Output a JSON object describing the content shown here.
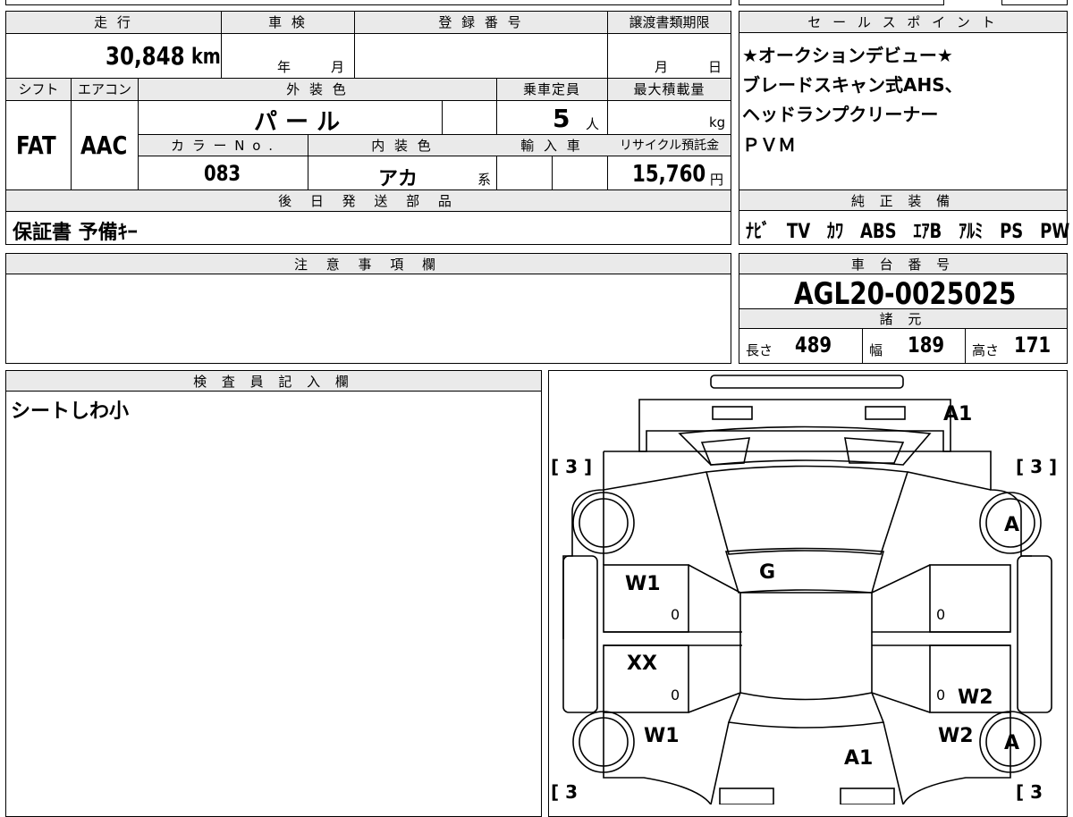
{
  "topstrip": {},
  "main": {
    "headers": {
      "mileage": "走 行",
      "inspection": "車 検",
      "registration": "登 録 番 号",
      "transfer_deadline": "譲渡書類期限",
      "shift": "シフト",
      "aircon": "エアコン",
      "exterior_color": "外 装 色",
      "capacity": "乗車定員",
      "max_load": "最大積載量",
      "color_no": "カ ラ ー N o .",
      "interior_color": "内 装 色",
      "import": "輸 入 車",
      "recycle_fee": "リサイクル預託金",
      "later_shipping": "後 日 発 送 部 品"
    },
    "mileage_value": "30,848",
    "mileage_unit": "km",
    "inspection_year_unit": "年",
    "inspection_month_unit": "月",
    "deadline_month_unit": "月",
    "deadline_day_unit": "日",
    "shift_value": "FAT",
    "aircon_value": "AAC",
    "exterior_color_value": "パ ー ル",
    "capacity_value": "5",
    "capacity_unit": "人",
    "max_load_unit": "kg",
    "color_no_value": "083",
    "interior_color_value": "アカ",
    "interior_color_suffix": "系",
    "recycle_fee_value": "15,760",
    "recycle_fee_unit": "円",
    "later_shipping_value": "保証書 予備ｷｰ"
  },
  "sales": {
    "header": "セ ー ル ス ポ イ ン ト",
    "lines": [
      "★オークションデビュー★",
      "ブレードスキャン式AHS、",
      "ヘッドランプクリーナー",
      "ＰＶＭ"
    ]
  },
  "equipment": {
    "header": "純 正 装 備",
    "items": [
      "ﾅﾋﾞ",
      "TV",
      "ｶﾜ",
      "ABS",
      "ｴｱB",
      "ｱﾙﾐ",
      "PS",
      "PW"
    ]
  },
  "notes": {
    "header": "注 意 事 項 欄"
  },
  "chassis": {
    "header": "車 台 番 号",
    "value": "AGL20-0025025",
    "specs_header": "諸 元",
    "length_label": "長さ",
    "length_value": "489",
    "width_label": "幅",
    "width_value": "189",
    "height_label": "高さ",
    "height_value": "171"
  },
  "inspector": {
    "header": "検 査 員 記 入 欄",
    "text": "シートしわ小"
  },
  "diagram": {
    "labels": {
      "rear_bumper": "A1",
      "front_bumper": "A1",
      "windshield": "G",
      "left_front_door": "W1",
      "left_rear_door": "XX",
      "left_rear_fender": "W1",
      "right_rear_door": "W2",
      "right_rear_fender": "W2",
      "right_top_wheel": "A",
      "right_bottom_wheel": "A",
      "tire_tl": "[ 3 ]",
      "tire_tr": "[ 3 ]",
      "tire_bl": "[ 3",
      "tire_br": "[ 3"
    },
    "zeros": [
      "0",
      "0",
      "0",
      "0"
    ]
  }
}
